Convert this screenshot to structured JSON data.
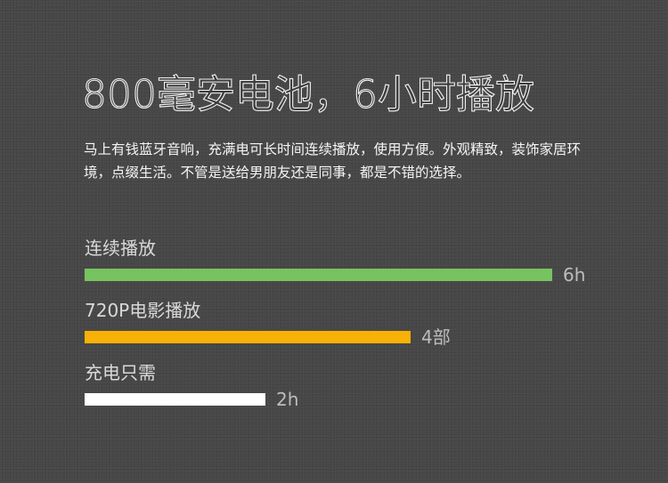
{
  "headline": "800毫安电池，6小时播放",
  "description": "马上有钱蓝牙音响，充满电可长时间连续播放，使用方便。外观精致，装饰家居环境，点缀生活。不管是送给男朋友还是同事，都是不错的选择。",
  "metrics": [
    {
      "label": "连续播放",
      "value": "6h",
      "level": 1.0,
      "color": "#77c35f"
    },
    {
      "label": "720P电影播放",
      "value": "4部",
      "level": 0.698,
      "color": "#f8b106"
    },
    {
      "label": "充电只需",
      "value": "2h",
      "level": 0.387,
      "color": "#ffffff"
    }
  ]
}
